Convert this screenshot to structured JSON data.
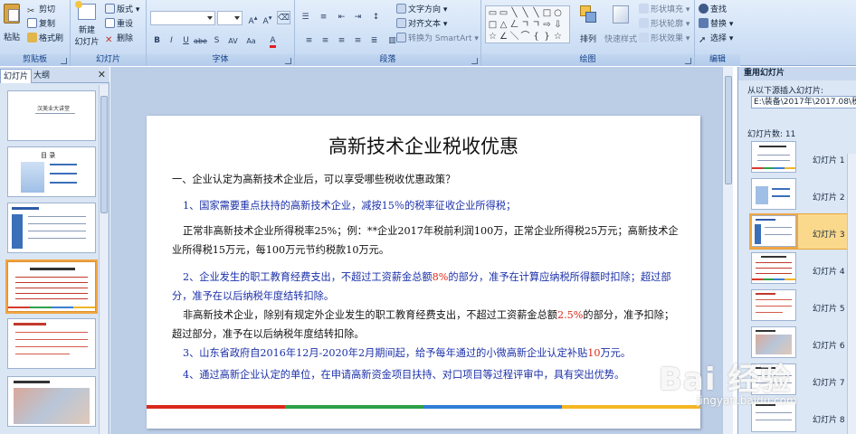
{
  "ribbon": {
    "clipboard": {
      "paste": "粘贴",
      "cut": "剪切",
      "copy": "复制",
      "format_painter": "格式刷",
      "label": "剪贴板"
    },
    "slides": {
      "new_slide": "新建",
      "new_slide_2": "幻灯片",
      "layout": "版式",
      "reset": "重设",
      "delete": "删除",
      "label": "幻灯片"
    },
    "font": {
      "label": "字体"
    },
    "paragraph": {
      "text_direction": "文字方向",
      "align_text": "对齐文本",
      "smartart": "转换为 SmartArt",
      "label": "段落"
    },
    "drawing": {
      "arrange": "排列",
      "quick_styles": "快速样式",
      "shape_fill": "形状填充",
      "shape_outline": "形状轮廓",
      "shape_effects": "形状效果",
      "label": "绘图"
    },
    "editing": {
      "find": "查找",
      "replace": "替换",
      "select": "选择",
      "label": "编辑"
    }
  },
  "left_pane": {
    "tabs": [
      "幻灯片",
      "大纲"
    ],
    "thumbnails": [
      {
        "title": "汉美业大讲堂"
      },
      {
        "title": "目 录"
      },
      {
        "title": ""
      },
      {
        "title": ""
      },
      {
        "title": ""
      },
      {
        "title": ""
      }
    ]
  },
  "slide": {
    "title": "高新技术企业税收优惠",
    "p1": "一、企业认定为高新技术企业后，可以享受哪些税收优惠政策？",
    "p2": "1、国家需要重点扶持的高新技术企业，减按15％的税率征收企业所得税；",
    "p3": "正常非高新技术企业所得税率25%；例：**企业2017年税前利润100万，正常企业所得税25万元；高新技术企业所得税15万元，每100万元节约税款10万元。",
    "p4_a": "2、企业发生的职工教育经费支出，不超过工资薪金总额",
    "p4_red": "8%",
    "p4_b": "的部分，准予在计算应纳税所得额时扣除；超过部分，准予在以后纳税年度结转扣除。",
    "p5_a": "非高新技术企业，除别有规定外企业发生的职工教育经费支出，不超过工资薪金总额",
    "p5_red": "2.5%",
    "p5_b": "的部分，准予扣除；超过部分，准予在以后纳税年度结转扣除。",
    "p6_a": "3、山东省政府自2016年12月-2020年2月期间起，给予每年通过的小微高新企业认定补贴",
    "p6_red": "10",
    "p6_b": "万元。",
    "p7": "4、通过高新企业认定的单位，在申请高新资金项目扶持、对口项目等过程评审中，具有突出优势。",
    "colors": [
      "#d9291c",
      "#2ea148",
      "#2f7fd6",
      "#f5b624"
    ]
  },
  "right_pane": {
    "title": "重用幻灯片",
    "insert_from": "从以下源插入幻灯片:",
    "path": "E:\\装备\\2017年\\2017.08\\税收",
    "count_label": "幻灯片数: 11",
    "items": [
      {
        "label": "幻灯片 1"
      },
      {
        "label": "幻灯片 2"
      },
      {
        "label": "幻灯片 3"
      },
      {
        "label": "幻灯片 4"
      },
      {
        "label": "幻灯片 5"
      },
      {
        "label": "幻灯片 6"
      },
      {
        "label": "幻灯片 7"
      },
      {
        "label": "幻灯片 8"
      }
    ]
  },
  "watermark": {
    "brand": "Bai 经验",
    "url": "jingyan.baidu.com"
  }
}
